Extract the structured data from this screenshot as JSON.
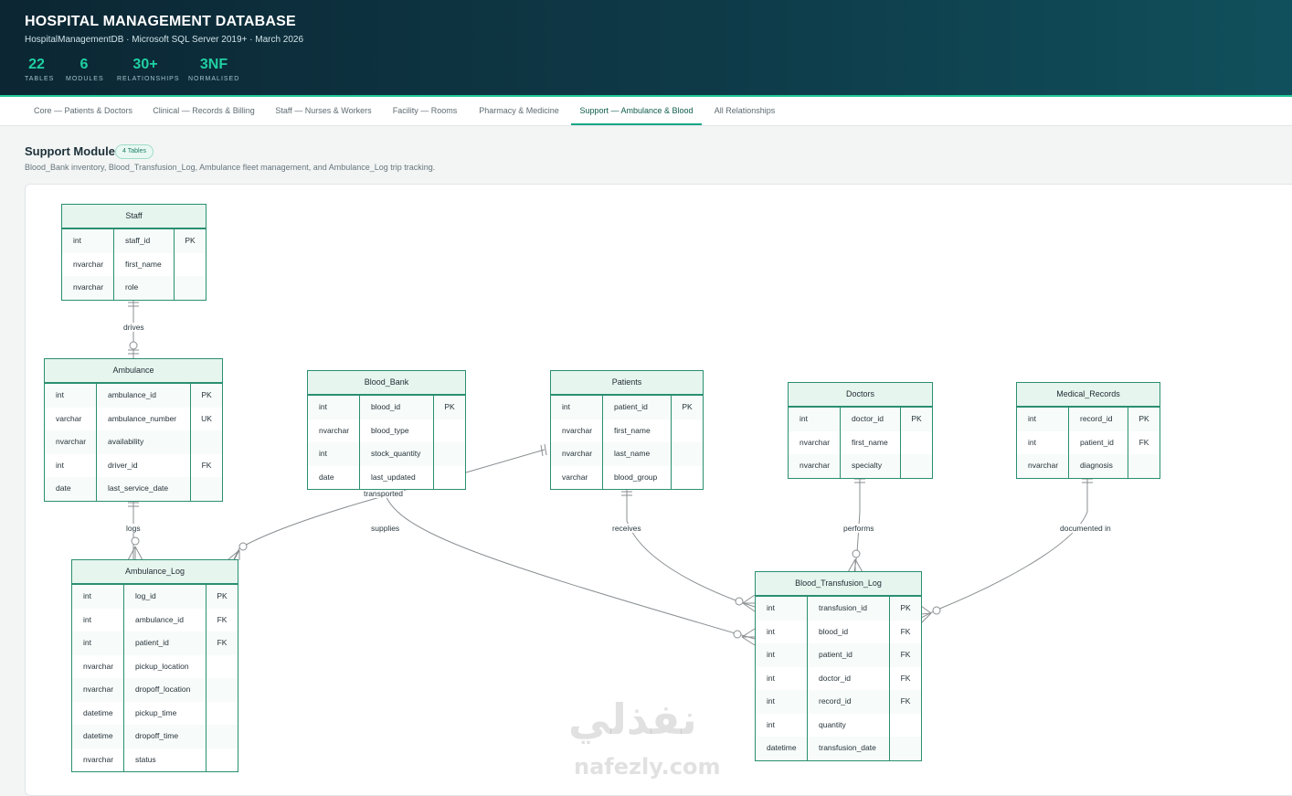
{
  "header": {
    "title": "HOSPITAL MANAGEMENT DATABASE",
    "subtitle": "HospitalManagementDB · Microsoft SQL Server 2019+ · March 2026",
    "stats": [
      {
        "value": "22",
        "label": "TABLES"
      },
      {
        "value": "6",
        "label": "MODULES"
      },
      {
        "value": "30+",
        "label": "RELATIONSHIPS"
      },
      {
        "value": "3NF",
        "label": "NORMALISED"
      }
    ]
  },
  "tabs": [
    {
      "label": "Core — Patients & Doctors",
      "active": false
    },
    {
      "label": "Clinical — Records & Billing",
      "active": false
    },
    {
      "label": "Staff — Nurses & Workers",
      "active": false
    },
    {
      "label": "Facility — Rooms",
      "active": false
    },
    {
      "label": "Pharmacy & Medicine",
      "active": false
    },
    {
      "label": "Support — Ambulance & Blood",
      "active": true
    },
    {
      "label": "All Relationships",
      "active": false
    }
  ],
  "module": {
    "title": "Support Module",
    "badge": "4 Tables",
    "description": "Blood_Bank inventory, Blood_Transfusion_Log, Ambulance fleet management, and Ambulance_Log trip tracking."
  },
  "entities": {
    "staff": {
      "name": "Staff",
      "columns": [
        {
          "type": "int",
          "name": "staff_id",
          "key": "PK"
        },
        {
          "type": "nvarchar",
          "name": "first_name",
          "key": ""
        },
        {
          "type": "nvarchar",
          "name": "role",
          "key": ""
        }
      ]
    },
    "ambulance": {
      "name": "Ambulance",
      "columns": [
        {
          "type": "int",
          "name": "ambulance_id",
          "key": "PK"
        },
        {
          "type": "varchar",
          "name": "ambulance_number",
          "key": "UK"
        },
        {
          "type": "nvarchar",
          "name": "availability",
          "key": ""
        },
        {
          "type": "int",
          "name": "driver_id",
          "key": "FK"
        },
        {
          "type": "date",
          "name": "last_service_date",
          "key": ""
        }
      ]
    },
    "blood_bank": {
      "name": "Blood_Bank",
      "columns": [
        {
          "type": "int",
          "name": "blood_id",
          "key": "PK"
        },
        {
          "type": "nvarchar",
          "name": "blood_type",
          "key": ""
        },
        {
          "type": "int",
          "name": "stock_quantity",
          "key": ""
        },
        {
          "type": "date",
          "name": "last_updated",
          "key": ""
        }
      ]
    },
    "patients": {
      "name": "Patients",
      "columns": [
        {
          "type": "int",
          "name": "patient_id",
          "key": "PK"
        },
        {
          "type": "nvarchar",
          "name": "first_name",
          "key": ""
        },
        {
          "type": "nvarchar",
          "name": "last_name",
          "key": ""
        },
        {
          "type": "varchar",
          "name": "blood_group",
          "key": ""
        }
      ]
    },
    "doctors": {
      "name": "Doctors",
      "columns": [
        {
          "type": "int",
          "name": "doctor_id",
          "key": "PK"
        },
        {
          "type": "nvarchar",
          "name": "first_name",
          "key": ""
        },
        {
          "type": "nvarchar",
          "name": "specialty",
          "key": ""
        }
      ]
    },
    "medical_records": {
      "name": "Medical_Records",
      "columns": [
        {
          "type": "int",
          "name": "record_id",
          "key": "PK"
        },
        {
          "type": "int",
          "name": "patient_id",
          "key": "FK"
        },
        {
          "type": "nvarchar",
          "name": "diagnosis",
          "key": ""
        }
      ]
    },
    "ambulance_log": {
      "name": "Ambulance_Log",
      "columns": [
        {
          "type": "int",
          "name": "log_id",
          "key": "PK"
        },
        {
          "type": "int",
          "name": "ambulance_id",
          "key": "FK"
        },
        {
          "type": "int",
          "name": "patient_id",
          "key": "FK"
        },
        {
          "type": "nvarchar",
          "name": "pickup_location",
          "key": ""
        },
        {
          "type": "nvarchar",
          "name": "dropoff_location",
          "key": ""
        },
        {
          "type": "datetime",
          "name": "pickup_time",
          "key": ""
        },
        {
          "type": "datetime",
          "name": "dropoff_time",
          "key": ""
        },
        {
          "type": "nvarchar",
          "name": "status",
          "key": ""
        }
      ]
    },
    "blood_transfusion_log": {
      "name": "Blood_Transfusion_Log",
      "columns": [
        {
          "type": "int",
          "name": "transfusion_id",
          "key": "PK"
        },
        {
          "type": "int",
          "name": "blood_id",
          "key": "FK"
        },
        {
          "type": "int",
          "name": "patient_id",
          "key": "FK"
        },
        {
          "type": "int",
          "name": "doctor_id",
          "key": "FK"
        },
        {
          "type": "int",
          "name": "record_id",
          "key": "FK"
        },
        {
          "type": "int",
          "name": "quantity",
          "key": ""
        },
        {
          "type": "datetime",
          "name": "transfusion_date",
          "key": ""
        }
      ]
    }
  },
  "relationships": [
    {
      "label": "drives"
    },
    {
      "label": "logs"
    },
    {
      "label": "transported"
    },
    {
      "label": "supplies"
    },
    {
      "label": "receives"
    },
    {
      "label": "performs"
    },
    {
      "label": "documented in"
    }
  ],
  "watermark": {
    "arabic": "نفذلي",
    "latin": "nafezly.com"
  }
}
